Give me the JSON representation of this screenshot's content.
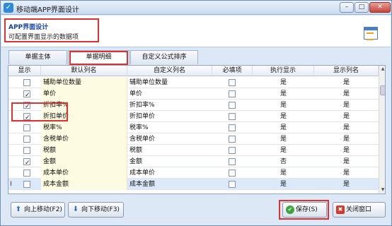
{
  "window": {
    "title": "移动端APP界面设计",
    "controls": {
      "minimize": "–",
      "maximize": "□",
      "close": "✕"
    }
  },
  "header": {
    "title": "APP界面设计",
    "subtitle": "可配置界面显示的数据项"
  },
  "tabs": [
    {
      "label": "单据主体",
      "active": false
    },
    {
      "label": "单据明细",
      "active": true
    },
    {
      "label": "自定义公式排序",
      "active": false
    }
  ],
  "table": {
    "columns": [
      "显示",
      "默认列名",
      "自定义列名",
      "必填项",
      "执行显示",
      "显示列名"
    ],
    "rows": [
      {
        "show": false,
        "default": "辅助单位数量",
        "custom": "辅助单位数量",
        "required": false,
        "exec": "是",
        "display": "是"
      },
      {
        "show": true,
        "default": "单价",
        "custom": "单价",
        "required": false,
        "exec": "是",
        "display": "是"
      },
      {
        "show": true,
        "default": "折扣率%",
        "custom": "折扣率%",
        "required": false,
        "exec": "是",
        "display": "是"
      },
      {
        "show": true,
        "default": "折扣单价",
        "custom": "折扣单价",
        "required": false,
        "exec": "是",
        "display": "是"
      },
      {
        "show": false,
        "default": "税率%",
        "custom": "税率%",
        "required": false,
        "exec": "是",
        "display": "是"
      },
      {
        "show": false,
        "default": "含税单价",
        "custom": "含税单价",
        "required": false,
        "exec": "是",
        "display": "是"
      },
      {
        "show": false,
        "default": "税额",
        "custom": "税额",
        "required": false,
        "exec": "是",
        "display": "是"
      },
      {
        "show": true,
        "default": "金额",
        "custom": "金额",
        "required": false,
        "exec": "否",
        "display": "是"
      },
      {
        "show": false,
        "default": "成本单价",
        "custom": "成本单价",
        "required": false,
        "exec": "是",
        "display": "是"
      },
      {
        "show": false,
        "default": "成本金额",
        "custom": "成本金额",
        "required": false,
        "exec": "是",
        "display": "是",
        "selected": true,
        "marker": "I"
      }
    ]
  },
  "buttons": {
    "move_up": "向上移动(F2)",
    "move_down": "向下移动(F3)",
    "save": "保存(S)",
    "close": "关闭窗口"
  },
  "colors": {
    "highlight_box": "#e03030",
    "header_title": "#1640a8",
    "selected_row": "#dbe9fb"
  },
  "icons": {
    "app": "app-icon",
    "header": "layout-icon",
    "move_up": "arrow-up-icon",
    "move_down": "arrow-down-icon",
    "save": "check-icon",
    "close": "close-icon"
  }
}
